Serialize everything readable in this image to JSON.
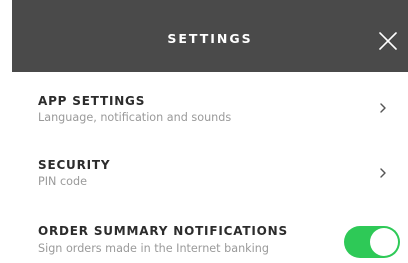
{
  "header": {
    "title": "SETTINGS",
    "close_icon": "close-icon"
  },
  "items": [
    {
      "title": "APP SETTINGS",
      "subtitle": "Language, notification and sounds",
      "icon": "chevron-right-icon"
    },
    {
      "title": "SECURITY",
      "subtitle": "PIN code",
      "icon": "chevron-right-icon"
    },
    {
      "title": "ORDER SUMMARY NOTIFICATIONS",
      "subtitle": "Sign orders made in the Internet banking",
      "toggle_on": true
    }
  ],
  "colors": {
    "header_bg": "#4a4a4a",
    "toggle_on": "#2ec957",
    "title_text": "#2c2c2c",
    "subtitle_text": "#9a9a9a"
  }
}
